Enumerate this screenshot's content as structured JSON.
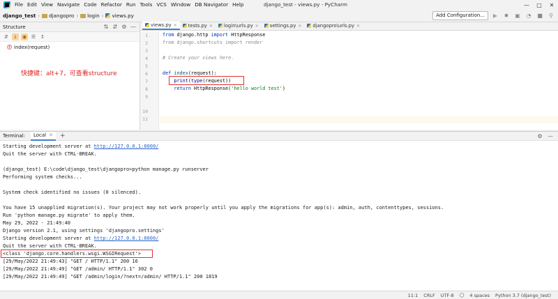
{
  "menu": {
    "items": [
      "File",
      "Edit",
      "View",
      "Navigate",
      "Code",
      "Refactor",
      "Run",
      "Tools",
      "VCS",
      "Window",
      "DB Navigator",
      "Help"
    ],
    "window_title": "django_test - views.py - PyCharm"
  },
  "breadcrumb": {
    "project": "django_test",
    "folder1": "djangopro",
    "folder2": "login",
    "file": "views.py"
  },
  "toolbar": {
    "add_config_label": "Add Configuration..."
  },
  "structure": {
    "title": "Structure",
    "item_badge": "f",
    "item_label": "index(request)",
    "annotation": "快捷键：alt+7，可查看structure"
  },
  "editor": {
    "tabs": [
      {
        "label": "views.py",
        "active": true
      },
      {
        "label": "tests.py",
        "active": false
      },
      {
        "label": "login\\urls.py",
        "active": false
      },
      {
        "label": "settings.py",
        "active": false
      },
      {
        "label": "djangopro\\urls.py",
        "active": false
      }
    ],
    "line_numbers": [
      "1",
      "2",
      "3",
      "4",
      "5",
      "6",
      "7",
      "8",
      "9",
      "10",
      "11"
    ],
    "lines": {
      "l1_kw1": "from",
      "l1_mod": " django.http ",
      "l1_kw2": "import",
      "l1_name": " HttpResponse",
      "l2": "from django.shortcuts import render",
      "l4": "# Create your views here.",
      "l6_kw": "def",
      "l6_fn": " index",
      "l6_rest": "(request):",
      "l7_indent": "    ",
      "l7_builtin": "print",
      "l7_p1": "(",
      "l7_builtin2": "type",
      "l7_rest": "(request))",
      "l8_indent": "    ",
      "l8_kw": "return",
      "l8_call": " HttpResponse(",
      "l8_str": "'hello world test'",
      "l8_close": ")"
    }
  },
  "terminal": {
    "label": "Terminal:",
    "tab": "Local",
    "plus": "+",
    "lines": {
      "t1_pre": "Starting development server at ",
      "t1_link": "http://127.0.0.1:8000/",
      "t2": "Quit the server with CTRL-BREAK.",
      "t3": "(django_test) E:\\code\\django_test\\djangopro>python manage.py runserver",
      "t4": "Performing system checks...",
      "t5": "System check identified no issues (0 silenced).",
      "t6": "You have 15 unapplied migration(s). Your project may not work properly until you apply the migrations for app(s): admin, auth, contenttypes, sessions.",
      "t7": "Run 'python manage.py migrate' to apply them.",
      "t8": "May 29, 2022 - 21:49:40",
      "t9": "Django version 2.1, using settings 'djangopro.settings'",
      "t10_pre": "Starting development server at ",
      "t10_link": "http://127.0.0.1:8000/",
      "t11": "Quit the server with CTRL-BREAK.",
      "t12": "<class 'django.core.handlers.wsgi.WSGIRequest'>",
      "t13": "[29/May/2022 21:49:43] \"GET / HTTP/1.1\" 200 16",
      "t14": "[29/May/2022 21:49:49] \"GET /admin/ HTTP/1.1\" 302 0",
      "t15": "[29/May/2022 21:49:49] \"GET /admin/login/?next=/admin/ HTTP/1.1\" 200 1819"
    }
  },
  "status": {
    "position": "11:1",
    "line_sep": "CRLF",
    "encoding": "UTF-8",
    "indent": "4 spaces",
    "interpreter": "Python 3.7 (django_test)"
  }
}
